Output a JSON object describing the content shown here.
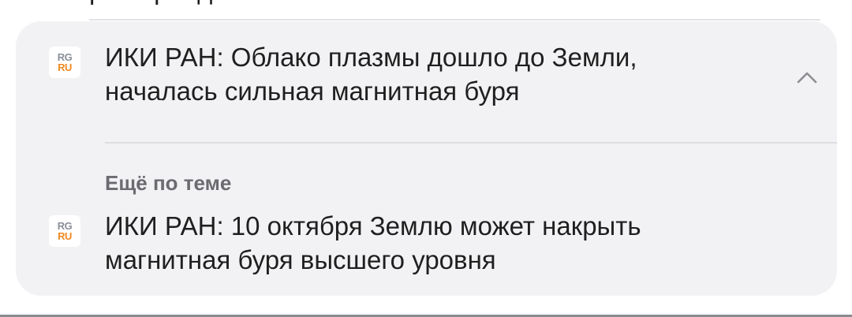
{
  "previous_item": {
    "partial_text": "р  е  п  р   е    д"
  },
  "card": {
    "main_item": {
      "source_logo_top": "RG",
      "source_logo_bottom": "RU",
      "headline": "ИКИ РАН: Облако плазмы дошло до Земли, началась сильная магнитная буря",
      "toggle_icon": "chevron-up-icon"
    },
    "related_section_label": "Ещё по теме",
    "related_items": [
      {
        "source_logo_top": "RG",
        "source_logo_bottom": "RU",
        "headline": "ИКИ РАН: 10 октября Землю может накрыть магнитная буря высшего уровня"
      }
    ]
  },
  "colors": {
    "card_background": "#f2f2f4",
    "text": "#1f1f1f",
    "secondary_text": "#6b6b70",
    "logo_gray": "#8a8f99",
    "logo_orange": "#f08a24"
  }
}
